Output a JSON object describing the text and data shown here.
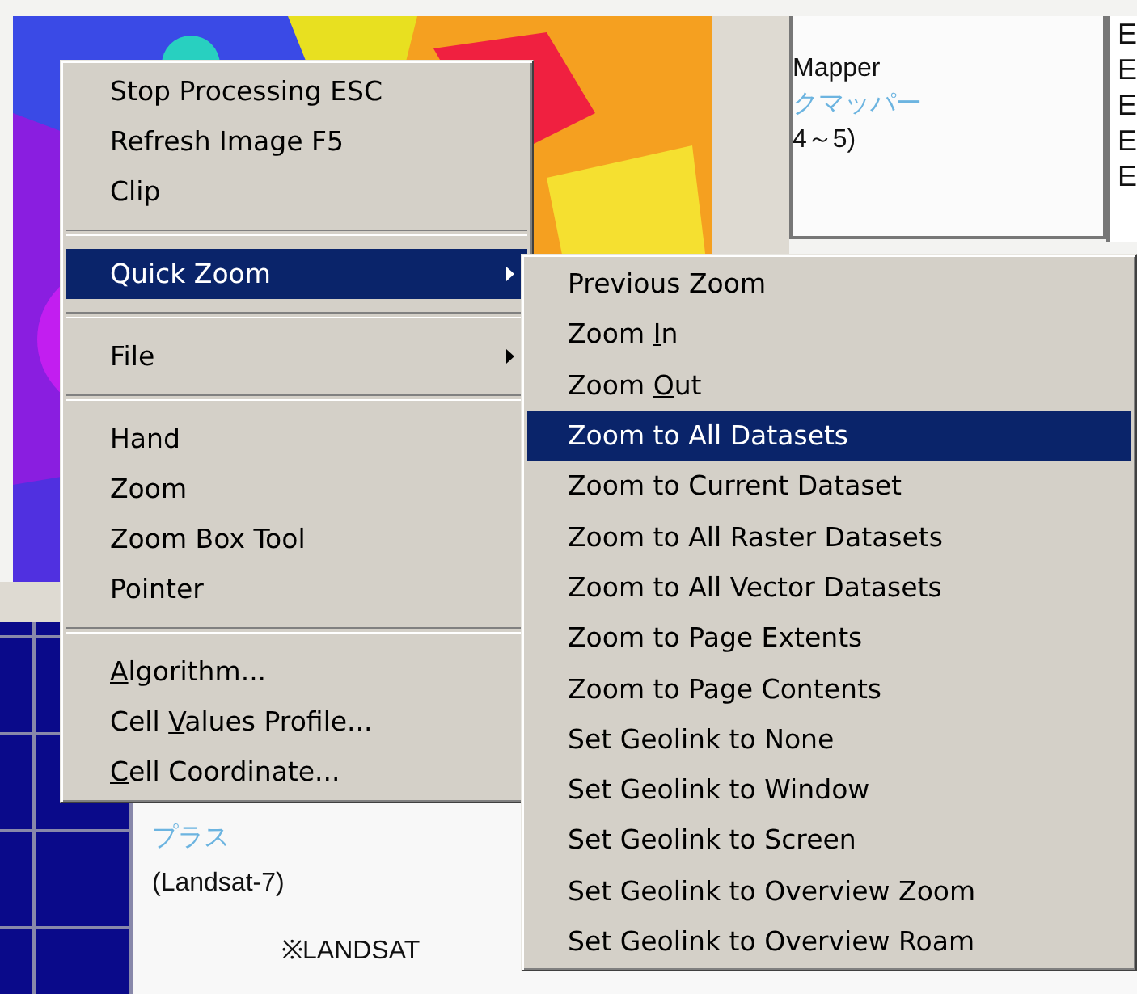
{
  "background": {
    "panel_lines": [
      {
        "text": "Mapper",
        "kind": "plain"
      },
      {
        "text": "クマッパー",
        "kind": "link"
      },
      {
        "text": "4～5)",
        "kind": "plain"
      }
    ],
    "side_letters": [
      "E",
      "E",
      "E",
      "E",
      "E"
    ],
    "lower_lines": [
      {
        "text": "プラス",
        "kind": "link"
      },
      {
        "text": "(Landsat-7)",
        "kind": "plain"
      }
    ],
    "footnote": "※LANDSAT"
  },
  "context_menu": {
    "groups": [
      [
        {
          "text": "Stop Processing ESC",
          "selected": false,
          "has_submenu": false
        },
        {
          "text": "Refresh Image F5",
          "selected": false,
          "has_submenu": false
        },
        {
          "text": "Clip",
          "selected": false,
          "has_submenu": false
        }
      ],
      [
        {
          "text": "Quick Zoom",
          "selected": true,
          "has_submenu": true
        }
      ],
      [
        {
          "text": "File",
          "selected": false,
          "has_submenu": true
        }
      ],
      [
        {
          "text": "Hand",
          "selected": false,
          "has_submenu": false
        },
        {
          "text": "Zoom",
          "selected": false,
          "has_submenu": false
        },
        {
          "text": "Zoom Box Tool",
          "selected": false,
          "has_submenu": false
        },
        {
          "text": "Pointer",
          "selected": false,
          "has_submenu": false
        }
      ],
      [
        {
          "key": "A",
          "after": "lgorithm...",
          "selected": false,
          "has_submenu": false
        },
        {
          "before": "Cell ",
          "key": "V",
          "after": "alues Profile...",
          "selected": false,
          "has_submenu": false
        },
        {
          "key": "C",
          "after": "ell Coordinate...",
          "selected": false,
          "has_submenu": false
        }
      ]
    ]
  },
  "submenu": {
    "items": [
      {
        "text": "Previous Zoom",
        "selected": false
      },
      {
        "before": "Zoom ",
        "key": "I",
        "after": "n",
        "selected": false
      },
      {
        "before": "Zoom ",
        "key": "O",
        "after": "ut",
        "selected": false
      },
      {
        "text": "Zoom to All Datasets",
        "selected": true
      },
      {
        "text": "Zoom to Current Dataset",
        "selected": false
      },
      {
        "text": "Zoom to All Raster Datasets",
        "selected": false
      },
      {
        "text": "Zoom to All Vector Datasets",
        "selected": false
      },
      {
        "text": "Zoom to Page Extents",
        "selected": false
      },
      {
        "text": "Zoom to Page Contents",
        "selected": false
      },
      {
        "text": "Set Geolink to None",
        "selected": false
      },
      {
        "text": "Set Geolink to Window",
        "selected": false
      },
      {
        "text": "Set Geolink to Screen",
        "selected": false
      },
      {
        "text": "Set Geolink to Overview Zoom",
        "selected": false
      },
      {
        "text": "Set Geolink to Overview Roam",
        "selected": false
      }
    ]
  }
}
